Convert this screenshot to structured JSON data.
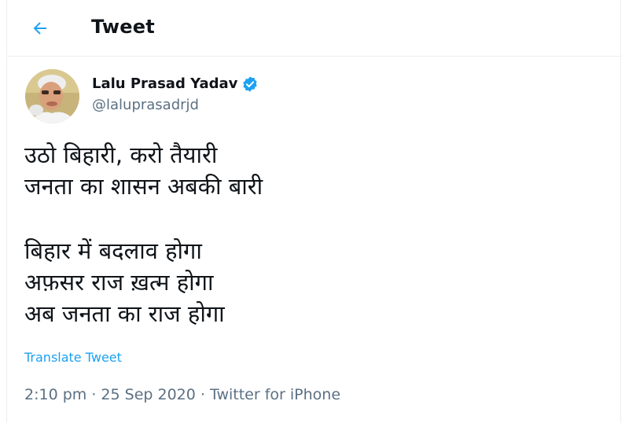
{
  "header": {
    "back_icon": "arrow-left-icon",
    "title": "Tweet"
  },
  "author": {
    "avatar_icon": "profile-photo",
    "name": "Lalu Prasad Yadav",
    "verified_icon": "verified-badge-icon",
    "handle": "@laluprasadrjd"
  },
  "tweet": {
    "lines": [
      "उठो बिहारी, करो तैयारी",
      "जनता का शासन अबकी बारी",
      "",
      "बिहार में बदलाव होगा",
      "अफ़सर राज ख़त्म होगा",
      "अब जनता का राज होगा"
    ],
    "translate_label": "Translate Tweet",
    "time": "2:10 pm",
    "separator": "·",
    "date": "25 Sep 2020",
    "source": "Twitter for iPhone"
  },
  "colors": {
    "accent": "#1da1f2",
    "secondary_text": "#5b7083",
    "border": "#ebeef0"
  }
}
